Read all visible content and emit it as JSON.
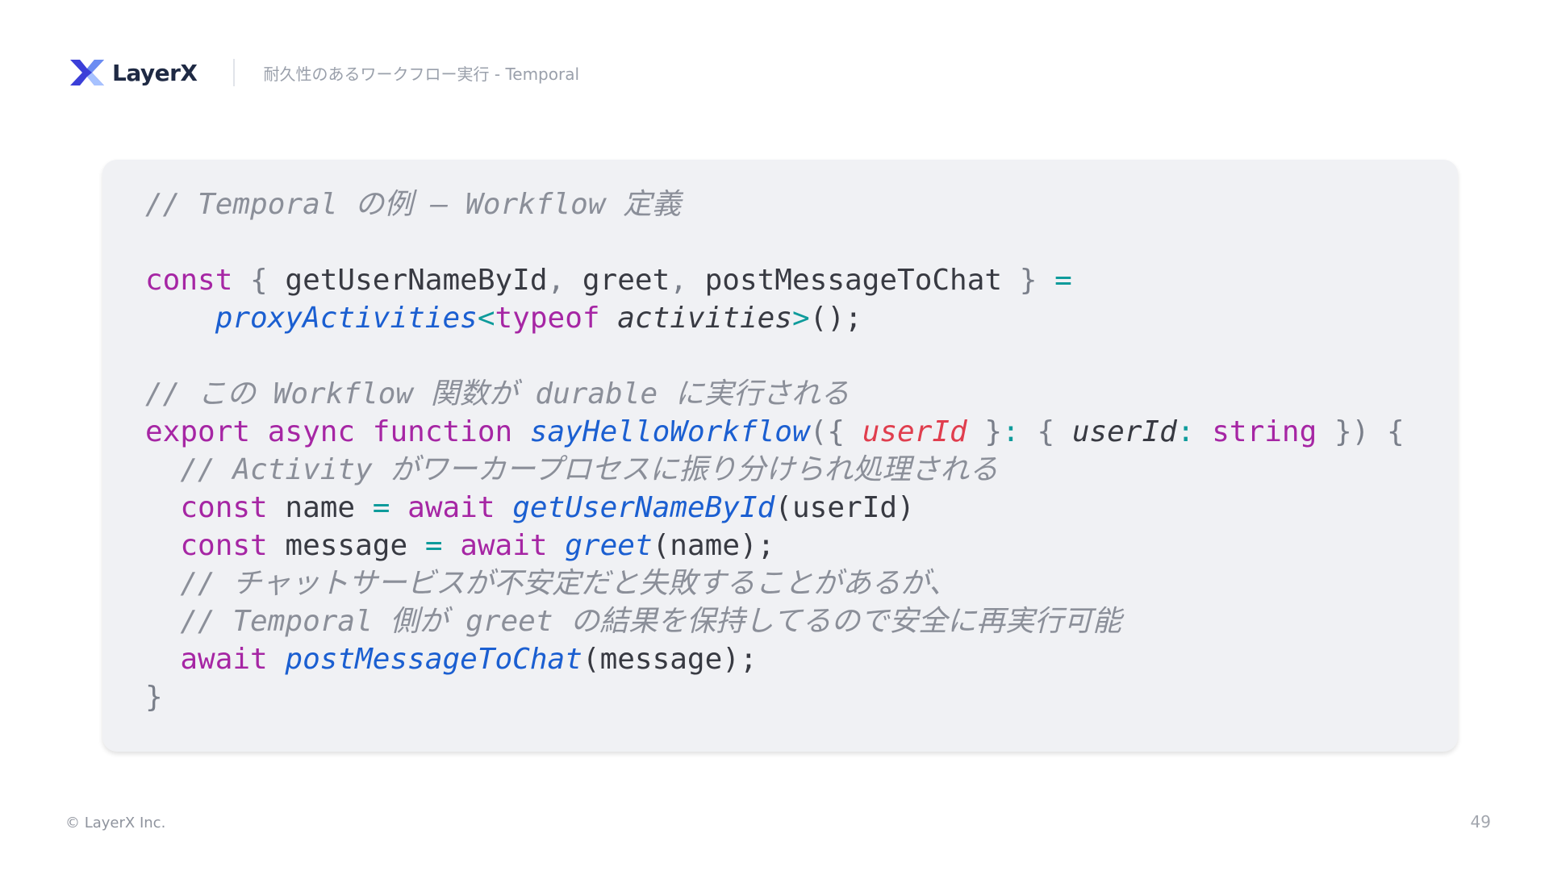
{
  "header": {
    "logo_text": "LayerX",
    "deck_title": "耐久性のあるワークフロー実行 - Temporal",
    "logo_icon": "layerx-logo-icon",
    "logo_colors": [
      "#3b3fd8",
      "#6b8cf2",
      "#a7c2ff"
    ]
  },
  "code": {
    "lines": [
      [
        {
          "t": "// Temporal の例 – Workflow 定義",
          "k": "comment"
        }
      ],
      [],
      [
        {
          "t": "const",
          "k": "keyword"
        },
        {
          "t": " { ",
          "k": "punct"
        },
        {
          "t": "getUserNameById",
          "k": "plain"
        },
        {
          "t": ", ",
          "k": "punct"
        },
        {
          "t": "greet",
          "k": "plain"
        },
        {
          "t": ", ",
          "k": "punct"
        },
        {
          "t": "postMessageToChat",
          "k": "plain"
        },
        {
          "t": " } ",
          "k": "punct"
        },
        {
          "t": "=",
          "k": "op"
        }
      ],
      [
        {
          "t": "    ",
          "k": "plain"
        },
        {
          "t": "proxyActivities",
          "k": "func"
        },
        {
          "t": "<",
          "k": "op"
        },
        {
          "t": "typeof",
          "k": "keyword"
        },
        {
          "t": " ",
          "k": "plain"
        },
        {
          "t": "activities",
          "k": "typeparam"
        },
        {
          "t": ">",
          "k": "op"
        },
        {
          "t": "();",
          "k": "plain"
        }
      ],
      [],
      [
        {
          "t": "// この Workflow 関数が durable に実行される",
          "k": "comment"
        }
      ],
      [
        {
          "t": "export",
          "k": "keyword"
        },
        {
          "t": " ",
          "k": "plain"
        },
        {
          "t": "async",
          "k": "keyword"
        },
        {
          "t": " ",
          "k": "plain"
        },
        {
          "t": "function",
          "k": "keyword"
        },
        {
          "t": " ",
          "k": "plain"
        },
        {
          "t": "sayHelloWorkflow",
          "k": "func"
        },
        {
          "t": "({ ",
          "k": "punct"
        },
        {
          "t": "userId",
          "k": "param"
        },
        {
          "t": " }",
          "k": "punct"
        },
        {
          "t": ":",
          "k": "op"
        },
        {
          "t": " { ",
          "k": "punct"
        },
        {
          "t": "userId",
          "k": "typeparam"
        },
        {
          "t": ":",
          "k": "op"
        },
        {
          "t": " ",
          "k": "plain"
        },
        {
          "t": "string",
          "k": "keyword"
        },
        {
          "t": " }) {",
          "k": "punct"
        }
      ],
      [
        {
          "t": "  ",
          "k": "plain"
        },
        {
          "t": "// Activity がワーカープロセスに振り分けられ処理される",
          "k": "comment"
        }
      ],
      [
        {
          "t": "  ",
          "k": "plain"
        },
        {
          "t": "const",
          "k": "keyword"
        },
        {
          "t": " name ",
          "k": "plain"
        },
        {
          "t": "=",
          "k": "op"
        },
        {
          "t": " ",
          "k": "plain"
        },
        {
          "t": "await",
          "k": "keyword"
        },
        {
          "t": " ",
          "k": "plain"
        },
        {
          "t": "getUserNameById",
          "k": "func"
        },
        {
          "t": "(userId)",
          "k": "plain"
        }
      ],
      [
        {
          "t": "  ",
          "k": "plain"
        },
        {
          "t": "const",
          "k": "keyword"
        },
        {
          "t": " message ",
          "k": "plain"
        },
        {
          "t": "=",
          "k": "op"
        },
        {
          "t": " ",
          "k": "plain"
        },
        {
          "t": "await",
          "k": "keyword"
        },
        {
          "t": " ",
          "k": "plain"
        },
        {
          "t": "greet",
          "k": "func"
        },
        {
          "t": "(name);",
          "k": "plain"
        }
      ],
      [
        {
          "t": "  ",
          "k": "plain"
        },
        {
          "t": "// チャットサービスが不安定だと失敗することがあるが、",
          "k": "comment"
        }
      ],
      [
        {
          "t": "  ",
          "k": "plain"
        },
        {
          "t": "// Temporal 側が greet の結果を保持してるので安全に再実行可能",
          "k": "comment"
        }
      ],
      [
        {
          "t": "  ",
          "k": "plain"
        },
        {
          "t": "await",
          "k": "keyword"
        },
        {
          "t": " ",
          "k": "plain"
        },
        {
          "t": "postMessageToChat",
          "k": "func"
        },
        {
          "t": "(message);",
          "k": "plain"
        }
      ],
      [
        {
          "t": "}",
          "k": "punct"
        }
      ]
    ],
    "colors": {
      "comment": "#8b8f99",
      "keyword": "#a626a4",
      "func": "#1b5fd1",
      "param": "#e03e4e",
      "op": "#0e9b9b",
      "plain": "#383a42",
      "background": "#f0f1f4"
    }
  },
  "footer": {
    "copyright": "© LayerX Inc.",
    "page_number": "49"
  }
}
